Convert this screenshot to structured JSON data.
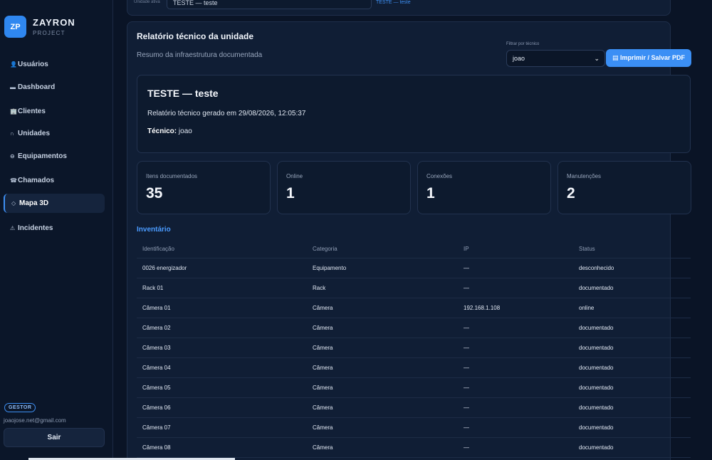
{
  "brand": {
    "logo": "ZP",
    "name": "ZAYRON",
    "sub": "PROJECT"
  },
  "sidebar": {
    "items": [
      {
        "icon": "👤",
        "label": "Usuários"
      },
      {
        "icon": "▬",
        "label": "Dashboard"
      },
      {
        "icon": "🏢",
        "label": "Clientes"
      },
      {
        "icon": "∩",
        "label": "Unidades"
      },
      {
        "icon": "⊖",
        "label": "Equipamentos"
      },
      {
        "icon": "☎",
        "label": "Chamados"
      },
      {
        "icon": "◇",
        "label": "Mapa 3D"
      },
      {
        "icon": "⚠",
        "label": "Incidentes"
      }
    ],
    "role": "GESTOR",
    "email": "joaojose.net@gmail.com",
    "logout": "Sair"
  },
  "topbar": {
    "label": "Unidade ativa",
    "value": "TESTE — teste",
    "link": "TESTE — teste"
  },
  "report": {
    "title": "Relatório técnico da unidade",
    "subtitle": "Resumo da infraestrutura documentada",
    "filter_label": "Filtrar por técnico",
    "filter_value": "joao",
    "print_label": "▤ Imprimir / Salvar PDF"
  },
  "info": {
    "title": "TESTE — teste",
    "generated": "Relatório técnico gerado em 29/08/2026, 12:05:37",
    "tech_label": "Técnico:",
    "tech_value": "joao"
  },
  "stats": [
    {
      "label": "Itens documentados",
      "value": "35"
    },
    {
      "label": "Online",
      "value": "1"
    },
    {
      "label": "Conexões",
      "value": "1"
    },
    {
      "label": "Manutenções",
      "value": "2"
    }
  ],
  "inventory": {
    "title": "Inventário",
    "headers": [
      "Identificação",
      "Categoria",
      "IP",
      "Status"
    ],
    "rows": [
      [
        "0026 energizador",
        "Equipamento",
        "—",
        "desconhecido"
      ],
      [
        "Rack 01",
        "Rack",
        "—",
        "documentado"
      ],
      [
        "Câmera 01",
        "Câmera",
        "192.168.1.108",
        "online"
      ],
      [
        "Câmera 02",
        "Câmera",
        "—",
        "documentado"
      ],
      [
        "Câmera 03",
        "Câmera",
        "—",
        "documentado"
      ],
      [
        "Câmera 04",
        "Câmera",
        "—",
        "documentado"
      ],
      [
        "Câmera 05",
        "Câmera",
        "—",
        "documentado"
      ],
      [
        "Câmera 06",
        "Câmera",
        "—",
        "documentado"
      ],
      [
        "Câmera 07",
        "Câmera",
        "—",
        "documentado"
      ],
      [
        "Câmera 08",
        "Câmera",
        "—",
        "documentado"
      ]
    ]
  }
}
